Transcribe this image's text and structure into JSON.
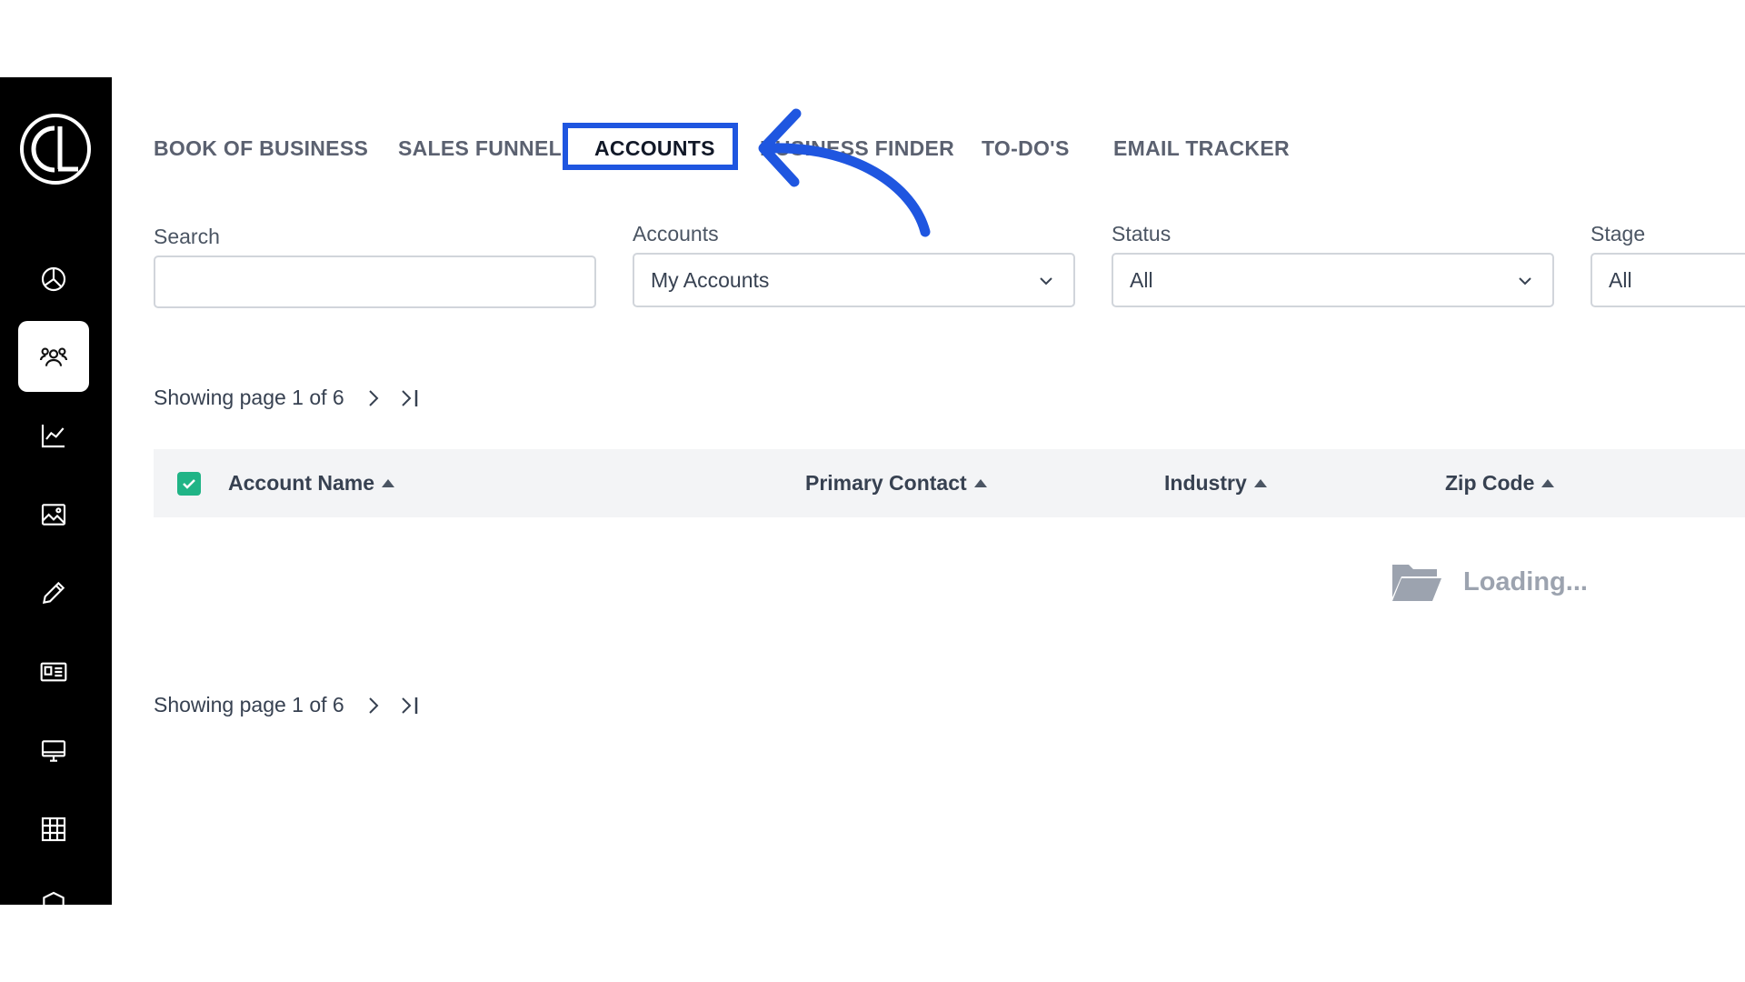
{
  "sidebar": {
    "logo": "CL",
    "items": [
      {
        "icon": "pie-chart-icon"
      },
      {
        "icon": "users-icon",
        "active": true
      },
      {
        "icon": "line-chart-icon"
      },
      {
        "icon": "image-icon"
      },
      {
        "icon": "pencil-icon"
      },
      {
        "icon": "id-card-icon"
      },
      {
        "icon": "monitor-icon"
      },
      {
        "icon": "grid-icon"
      },
      {
        "icon": "shield-icon"
      }
    ]
  },
  "tabs": [
    {
      "label": "BOOK OF BUSINESS"
    },
    {
      "label": "SALES FUNNEL"
    },
    {
      "label": "ACCOUNTS",
      "active": true
    },
    {
      "label": "BUSINESS FINDER"
    },
    {
      "label": "TO-DO'S"
    },
    {
      "label": "EMAIL TRACKER"
    }
  ],
  "filters": {
    "search": {
      "label": "Search",
      "value": ""
    },
    "accounts": {
      "label": "Accounts",
      "value": "My Accounts"
    },
    "status": {
      "label": "Status",
      "value": "All"
    },
    "stage": {
      "label": "Stage",
      "value": "All"
    }
  },
  "pagination": {
    "text": "Showing page 1 of 6"
  },
  "table": {
    "columns": [
      "Account Name",
      "Primary Contact",
      "Industry",
      "Zip Code"
    ],
    "loading_text": "Loading..."
  },
  "colors": {
    "highlight": "#1f56e0",
    "checkbox": "#20b486",
    "sidebar_bg": "#000000"
  }
}
